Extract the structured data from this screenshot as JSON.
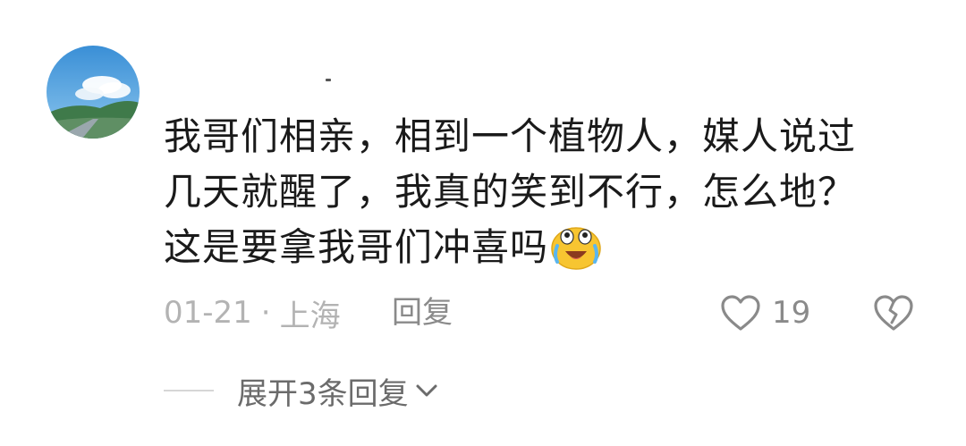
{
  "comment": {
    "lines": [
      "我哥们相亲，相到一个植物人，媒人说过",
      "几天就醒了，我真的笑到不行，怎么地？",
      "这是要拿我哥们冲喜吗"
    ],
    "emoji": "laughing-crying-emoji"
  },
  "meta": {
    "date": "01-21",
    "separator": "·",
    "location": "上海",
    "reply_label": "回复"
  },
  "actions": {
    "like_count": "19",
    "like_icon": "heart-outline-icon",
    "dislike_icon": "broken-heart-icon"
  },
  "replies": {
    "expand_label": "展开3条回复",
    "expand_icon": "chevron-down-icon"
  },
  "colors": {
    "text": "#1a1a1a",
    "meta": "#b3b3b3",
    "action": "#8a8a8a"
  }
}
